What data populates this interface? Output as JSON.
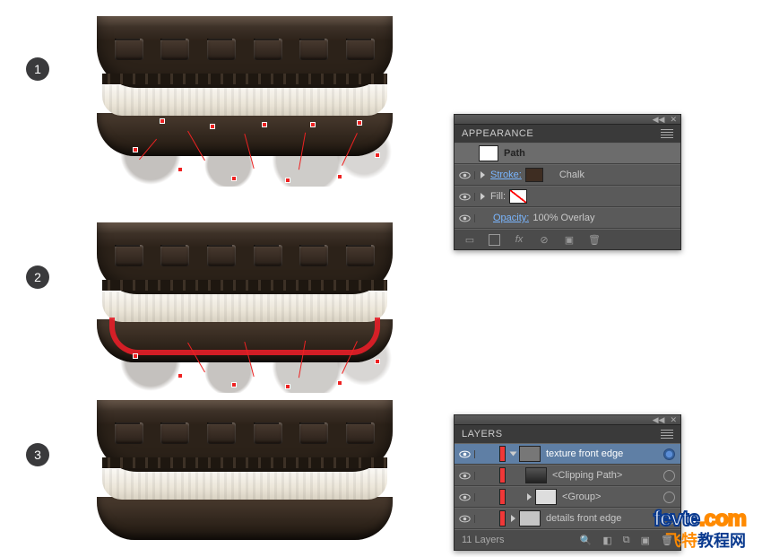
{
  "steps": {
    "s1": "1",
    "s2": "2",
    "s3": "3"
  },
  "appearance": {
    "title": "APPEARANCE",
    "object_label": "Path",
    "stroke_label": "Stroke:",
    "stroke_color": "#3e2d22",
    "stroke_name": "Chalk",
    "fill_label": "Fill:",
    "opacity_label": "Opacity:",
    "opacity_value": "100% Overlay",
    "footer_fx": "fx"
  },
  "layers": {
    "title": "LAYERS",
    "items": [
      {
        "name": "texture front edge",
        "selected": true
      },
      {
        "name": "<Clipping Path>",
        "selected": false
      },
      {
        "name": "<Group>",
        "selected": false
      },
      {
        "name": "details front edge",
        "selected": false
      }
    ],
    "count": "11 Layers"
  },
  "watermark": {
    "en1": "fevte",
    "en2": ".com",
    "cn1": "飞特",
    "cn2": "教程网"
  }
}
